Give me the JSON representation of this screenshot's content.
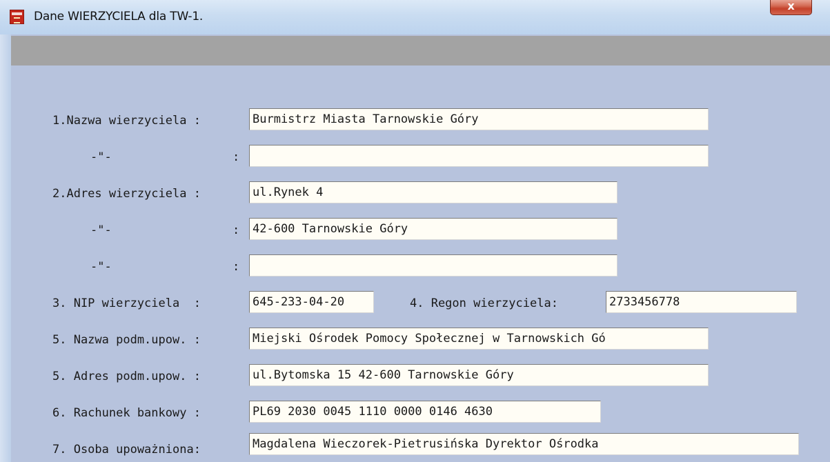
{
  "window": {
    "title": "Dane WIERZYCIELA dla TW-1.",
    "close_label": "x"
  },
  "form": {
    "rows": [
      {
        "label": "1.Nazwa wierzyciela :",
        "value": "Burmistrz Miasta Tarnowskie Góry"
      },
      {
        "label": "-\"-",
        "colon": ":",
        "value": ""
      },
      {
        "label": "2.Adres wierzyciela :",
        "value": "ul.Rynek 4"
      },
      {
        "label": "-\"-",
        "colon": ":",
        "value": "42-600 Tarnowskie Góry"
      },
      {
        "label": "-\"-",
        "colon": ":",
        "value": ""
      },
      {
        "label": "3. NIP wierzyciela  :",
        "value": "645-233-04-20",
        "label2": "4. Regon wierzyciela:",
        "value2": "2733456778"
      },
      {
        "label": "5. Nazwa podm.upow. :",
        "value": "Miejski Ośrodek Pomocy Społecznej w Tarnowskich Gó"
      },
      {
        "label": "5. Adres podm.upow. :",
        "value": "ul.Bytomska 15 42-600 Tarnowskie Góry"
      },
      {
        "label": "6. Rachunek bankowy :",
        "value": "PL69 2030 0045 1110 0000 0146 4630"
      },
      {
        "label": "7. Osoba upoważniona:",
        "value": "Magdalena Wieczorek-Pietrusińska Dyrektor Ośrodka"
      }
    ]
  }
}
